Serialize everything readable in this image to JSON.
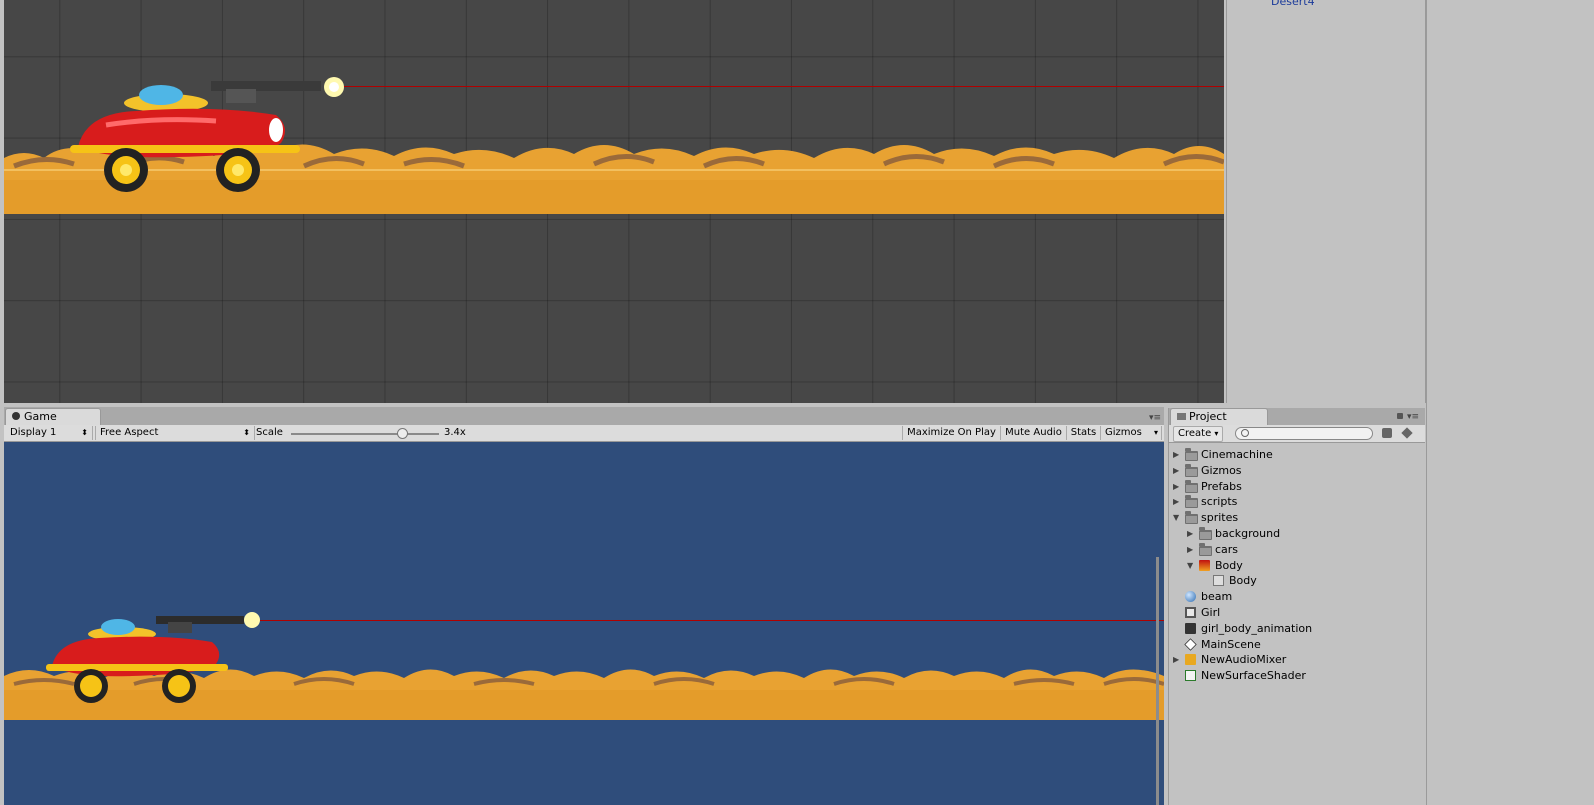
{
  "inspector": {
    "link_text": "Desert4"
  },
  "game": {
    "tab_label": "Game",
    "display": "Display 1",
    "aspect": "Free Aspect",
    "scale_label": "Scale",
    "scale_value": "3.4x",
    "scale_fraction": 0.75,
    "maximize": "Maximize On Play",
    "mute": "Mute Audio",
    "stats": "Stats",
    "gizmos": "Gizmos"
  },
  "project": {
    "tab_label": "Project",
    "create": "Create",
    "search_placeholder": "",
    "items": [
      {
        "label": "Cinemachine",
        "icon": "folder-icon",
        "depth": 0,
        "expand": "collapsed"
      },
      {
        "label": "Gizmos",
        "icon": "folder-icon",
        "depth": 0,
        "expand": "collapsed"
      },
      {
        "label": "Prefabs",
        "icon": "folder-icon",
        "depth": 0,
        "expand": "collapsed"
      },
      {
        "label": "scripts",
        "icon": "folder-icon",
        "depth": 0,
        "expand": "collapsed"
      },
      {
        "label": "sprites",
        "icon": "folder-icon",
        "depth": 0,
        "expand": "expanded"
      },
      {
        "label": "background",
        "icon": "folder-icon",
        "depth": 1,
        "expand": "collapsed"
      },
      {
        "label": "cars",
        "icon": "folder-icon",
        "depth": 1,
        "expand": "collapsed"
      },
      {
        "label": "Body",
        "icon": "sprite-sheet-icon",
        "depth": 1,
        "expand": "expanded"
      },
      {
        "label": "Body",
        "icon": "sprite-icon",
        "depth": 2,
        "expand": "none"
      },
      {
        "label": "beam",
        "icon": "material-sphere-icon",
        "depth": 0,
        "expand": "none"
      },
      {
        "label": "Girl",
        "icon": "prefab-icon",
        "depth": 0,
        "expand": "none"
      },
      {
        "label": "girl_body_animation",
        "icon": "animation-clip-icon",
        "depth": 0,
        "expand": "none"
      },
      {
        "label": "MainScene",
        "icon": "unity-scene-icon",
        "depth": 0,
        "expand": "none"
      },
      {
        "label": "NewAudioMixer",
        "icon": "audio-mixer-icon",
        "depth": 0,
        "expand": "collapsed"
      },
      {
        "label": "NewSurfaceShader",
        "icon": "shader-icon",
        "depth": 0,
        "expand": "none"
      }
    ]
  },
  "colors": {
    "scene_bg": "#474747",
    "game_bg": "#2f4d7b",
    "sand": "#e49c2a",
    "sand_dark": "#c8822a",
    "laser": "#b00000",
    "car_red": "#d81c1c"
  }
}
